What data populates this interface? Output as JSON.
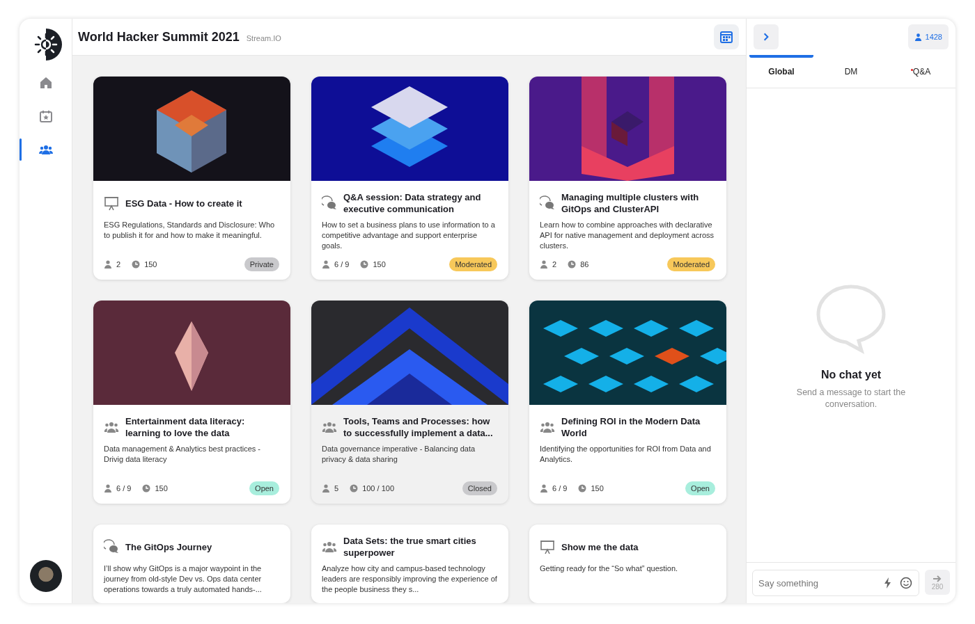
{
  "header": {
    "title": "World Hacker Summit 2021",
    "subtitle": "Stream.IO"
  },
  "nav": [
    {
      "selected": false
    },
    {
      "selected": false
    },
    {
      "selected": true
    }
  ],
  "cards": [
    {
      "kind": "presentation",
      "title": "ESG Data - How to create it",
      "description": "ESG Regulations, Standards and Disclosure: Who to publish it for and how to make it meaningful.",
      "people": "2",
      "time": "150",
      "status": {
        "label": "Private",
        "kind": "private"
      }
    },
    {
      "kind": "chat",
      "title": "Q&A session: Data strategy and executive communication",
      "description": "How to set a business plans to use information to a competitive advantage and support enterprise goals.",
      "people": "6 / 9",
      "time": "150",
      "status": {
        "label": "Moderated",
        "kind": "moderated"
      }
    },
    {
      "kind": "chat",
      "title": "Managing multiple clusters with GitOps and ClusterAPI",
      "description": "Learn how to combine approaches with declarative API for native management and deployment across clusters.",
      "people": "2",
      "time": "86",
      "status": {
        "label": "Moderated",
        "kind": "moderated"
      }
    },
    {
      "kind": "group",
      "title": "Entertainment data literacy: learning to love the data",
      "description": "Data management & Analytics best practices - Drivig data literacy",
      "people": "6 / 9",
      "time": "150",
      "status": {
        "label": "Open",
        "kind": "open"
      }
    },
    {
      "kind": "group",
      "title": "Tools, Teams and Processes: how to successfully implement a data...",
      "description": "Data governance imperative - Balancing data privacy & data sharing",
      "people": "5",
      "time": "100 / 100",
      "status": {
        "label": "Closed",
        "kind": "closed"
      }
    },
    {
      "kind": "group",
      "title": "Defining ROI in the Modern Data World",
      "description": "Identifying the opportunities for ROI from Data and Analytics.",
      "people": "6 / 9",
      "time": "150",
      "status": {
        "label": "Open",
        "kind": "open"
      }
    },
    {
      "kind": "chat",
      "title": "The GitOps Journey",
      "description": "I’ll show why GitOps is a major waypoint in the journey from old-style Dev vs. Ops data center operations towards a truly automated hands-..."
    },
    {
      "kind": "group",
      "title": "Data Sets: the true smart cities superpower",
      "description": "Analyze how city and campus-based technology leaders are responsibly improving the experience of the people business they s..."
    },
    {
      "kind": "presentation",
      "title": "Show me the data",
      "description": "Getting ready for the “So what” question."
    }
  ],
  "chat": {
    "online_count": "1428",
    "tabs": [
      {
        "label": "Global",
        "selected": true,
        "unread": false
      },
      {
        "label": "DM",
        "selected": false,
        "unread": false
      },
      {
        "label": "Q&A",
        "selected": false,
        "unread": true
      }
    ],
    "empty_title": "No chat yet",
    "empty_text": "Send a message to start the conversation.",
    "input": {
      "placeholder": "Say something"
    },
    "char_limit": "280"
  }
}
